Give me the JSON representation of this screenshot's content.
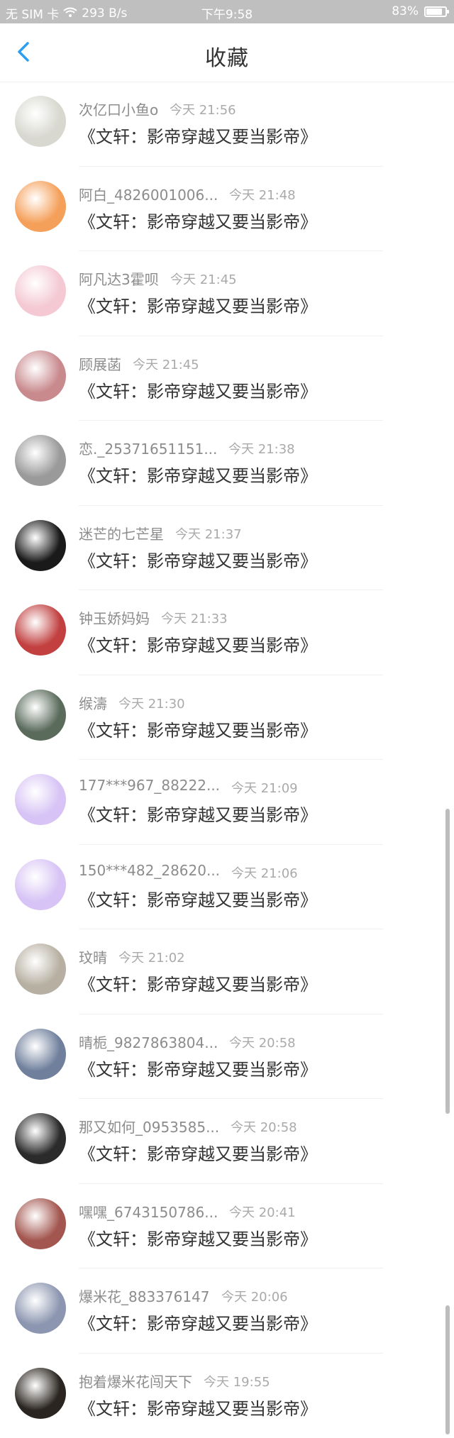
{
  "status_bar": {
    "sim": "无 SIM 卡",
    "speed": "293 B/s",
    "time": "下午9:58",
    "battery": "83%"
  },
  "header": {
    "title": "收藏"
  },
  "items": [
    {
      "name": "次亿口小鱼o",
      "time": "今天 21:56",
      "book": "《文轩：影帝穿越又要当影帝》",
      "avatar_color": "#d8d8d0"
    },
    {
      "name": "阿白_4826001006...",
      "time": "今天 21:48",
      "book": "《文轩：影帝穿越又要当影帝》",
      "avatar_color": "#f5a05a"
    },
    {
      "name": "阿凡达3霍呗",
      "time": "今天 21:45",
      "book": "《文轩：影帝穿越又要当影帝》",
      "avatar_color": "#f4c9d4"
    },
    {
      "name": "顾展菡",
      "time": "今天 21:45",
      "book": "《文轩：影帝穿越又要当影帝》",
      "avatar_color": "#c98a8e"
    },
    {
      "name": "恋._25371651151...",
      "time": "今天 21:38",
      "book": "《文轩：影帝穿越又要当影帝》",
      "avatar_color": "#9a9a9a"
    },
    {
      "name": "迷芒的七芒星",
      "time": "今天 21:37",
      "book": "《文轩：影帝穿越又要当影帝》",
      "avatar_color": "#1a1a1a"
    },
    {
      "name": "钟玉娇妈妈",
      "time": "今天 21:33",
      "book": "《文轩：影帝穿越又要当影帝》",
      "avatar_color": "#c24040"
    },
    {
      "name": "缑濤",
      "time": "今天 21:30",
      "book": "《文轩：影帝穿越又要当影帝》",
      "avatar_color": "#5a6b5c"
    },
    {
      "name": "177***967_88222...",
      "time": "今天 21:09",
      "book": "《文轩：影帝穿越又要当影帝》",
      "avatar_color": "#d7c3f5"
    },
    {
      "name": "150***482_28620...",
      "time": "今天 21:06",
      "book": "《文轩：影帝穿越又要当影帝》",
      "avatar_color": "#d7c3f5"
    },
    {
      "name": "玟晴",
      "time": "今天 21:02",
      "book": "《文轩：影帝穿越又要当影帝》",
      "avatar_color": "#b7b0a2"
    },
    {
      "name": "晴栀_9827863804...",
      "time": "今天 20:58",
      "book": "《文轩：影帝穿越又要当影帝》",
      "avatar_color": "#6f7f9c"
    },
    {
      "name": "那又如何_0953585...",
      "time": "今天 20:58",
      "book": "《文轩：影帝穿越又要当影帝》",
      "avatar_color": "#2b2b2b"
    },
    {
      "name": "嘿嘿_6743150786...",
      "time": "今天 20:41",
      "book": "《文轩：影帝穿越又要当影帝》",
      "avatar_color": "#a3564f"
    },
    {
      "name": "爆米花_883376147",
      "time": "今天 20:06",
      "book": "《文轩：影帝穿越又要当影帝》",
      "avatar_color": "#8c96b0"
    },
    {
      "name": "抱着爆米花闯天下",
      "time": "今天 19:55",
      "book": "《文轩：影帝穿越又要当影帝》",
      "avatar_color": "#2a2520"
    }
  ],
  "colors": {
    "accent": "#2f9df0",
    "status_bar_bg": "#bfbfbf",
    "muted_text": "#8c8c8c"
  }
}
